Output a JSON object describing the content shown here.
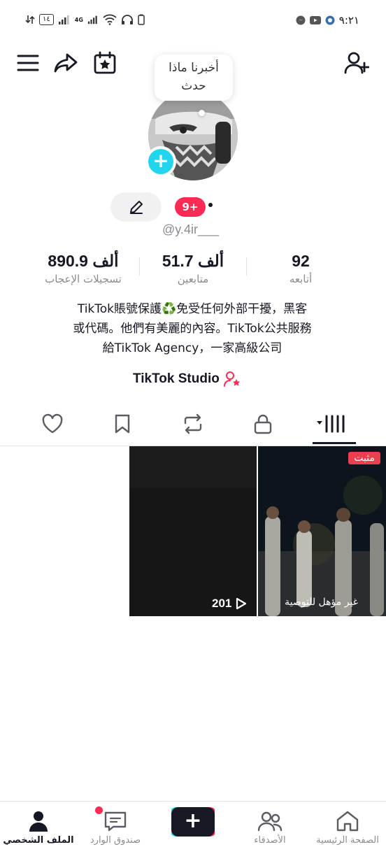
{
  "status_bar": {
    "time": "٩:٢١",
    "battery": "١٤",
    "network": "4G"
  },
  "profile": {
    "note_prompt": "أخبرنا ماذا حدث",
    "notification_badge": "9+",
    "username": "@y.4ir___"
  },
  "stats": [
    {
      "value": "92",
      "label": "أتابعه"
    },
    {
      "value": "51.7 ألف",
      "label": "متابعين"
    },
    {
      "value": "890.9 ألف",
      "label": "تسجيلات الإعجاب"
    }
  ],
  "bio": {
    "line1": "TikTok賬號保護♻️免受任何外部干擾，黑客",
    "line2": "或代碼。他們有美麗的內容。TikTok公共服務",
    "line3": "給TikTok Agency，一家高級公司"
  },
  "studio_label": "TikTok Studio",
  "videos": [
    {
      "views": "201",
      "pinned": "",
      "caption": ""
    },
    {
      "views": "",
      "pinned": "مثبت",
      "caption": "غير مؤهل للتوصية"
    }
  ],
  "bottom_nav": {
    "home": "الصفحة الرئيسية",
    "friends": "الأصدقاء",
    "create": "+",
    "inbox": "صندوق الوارد",
    "profile": "الملف الشخصي"
  },
  "colors": {
    "accent": "#fe2c55",
    "cyan": "#20d5ec",
    "text": "#161823",
    "muted": "#8a8b91"
  }
}
